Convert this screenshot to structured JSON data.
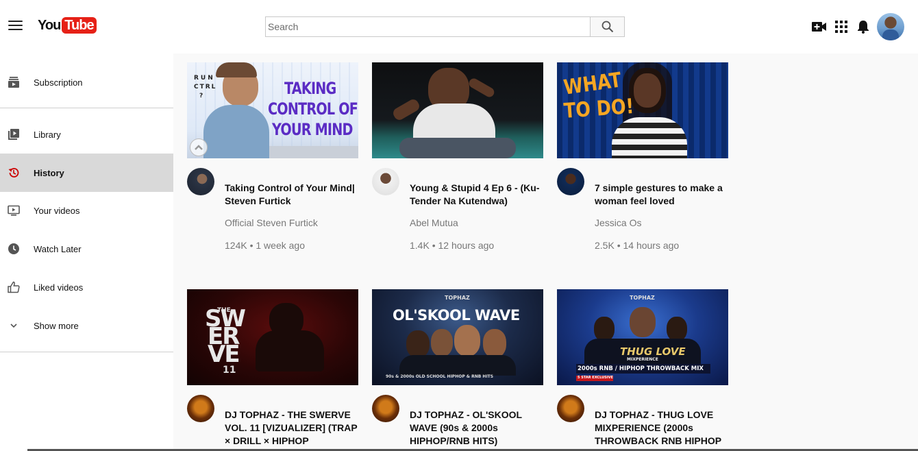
{
  "header": {
    "logo_you": "You",
    "logo_tube": "Tube",
    "search_placeholder": "Search",
    "icons": [
      "menu-icon",
      "search-icon",
      "create-video-icon",
      "apps-grid-icon",
      "notification-bell-icon",
      "user-avatar"
    ]
  },
  "sidebar": {
    "items": [
      {
        "label": "Subscription",
        "icon": "subscriptions-icon"
      },
      {
        "label": "Library",
        "icon": "library-icon"
      },
      {
        "label": "History",
        "icon": "history-icon",
        "active": true
      },
      {
        "label": "Your videos",
        "icon": "your-videos-icon"
      },
      {
        "label": "Watch Later",
        "icon": "clock-icon"
      },
      {
        "label": "Liked videos",
        "icon": "thumbs-up-icon"
      },
      {
        "label": "Show more",
        "icon": "chevron-down-icon"
      }
    ]
  },
  "colors": {
    "brand": "#e62117",
    "active_bg": "#d9d9d9",
    "history_icon": "#cc0000"
  },
  "videos": [
    {
      "title": "Taking Control of Your Mind| Steven Furtick",
      "channel": "Official Steven Furtick",
      "meta": "124K • 1 week ago",
      "thumb_text": [
        "RUN",
        "CTRL",
        "?",
        "TAKING",
        "CONTROL OF",
        "YOUR MIND"
      ]
    },
    {
      "title": "Young & Stupid 4 Ep 6 - (Ku-Tender Na Kutendwa)",
      "channel": "Abel Mutua",
      "meta": "1.4K • 12 hours ago",
      "thumb_text": []
    },
    {
      "title": "7 simple gestures to make a woman feel loved",
      "channel": "Jessica Os",
      "meta": "2.5K • 14 hours ago",
      "thumb_text": [
        "WHAT",
        "TO DO!"
      ]
    },
    {
      "title": "DJ TOPHAZ - THE SWERVE VOL. 11 [VIZUALIZER] (TRAP × DRILL × HIPHOP",
      "channel": "",
      "meta": "",
      "thumb_text": [
        "THE",
        "SW",
        "ER",
        "VE",
        "11"
      ]
    },
    {
      "title": "DJ TOPHAZ - OL'SKOOL WAVE (90s & 2000s HIPHOP/RNB HITS)",
      "channel": "",
      "meta": "",
      "thumb_text": [
        "TOPHAZ",
        "OL'SKOOL WAVE",
        "90s & 2000s OLD SCHOOL HIPHOP & RNB HITS"
      ]
    },
    {
      "title": "DJ TOPHAZ - THUG LOVE MIXPERIENCE (2000s THROWBACK RNB HIPHOP",
      "channel": "",
      "meta": "",
      "thumb_text": [
        "TOPHAZ",
        "THUG LOVE",
        "MIXPERIENCE",
        "2000s RNB / HIPHOP THROWBACK MIX",
        "5 STAR EXCLUSIVE"
      ]
    }
  ]
}
